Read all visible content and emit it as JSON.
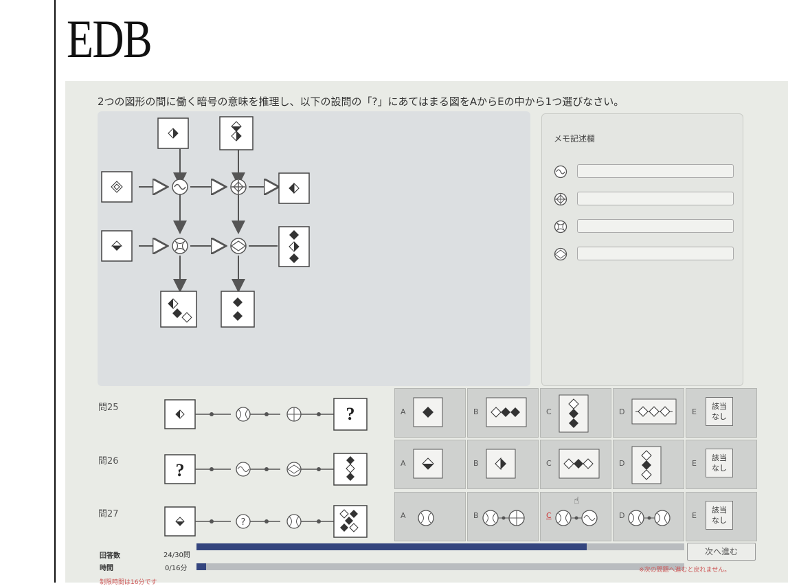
{
  "brand": "EDB",
  "instruction": "2つの図形の間に働く暗号の意味を推理し、以下の設問の「?」にあてはまる図をAからEの中から1つ選びなさい。",
  "memo": {
    "title": "メモ記述欄",
    "rows": [
      {
        "symbol": "wave-circle-icon",
        "value": ""
      },
      {
        "symbol": "cross-circle-icon",
        "value": ""
      },
      {
        "symbol": "swirl-circle-icon",
        "value": ""
      },
      {
        "symbol": "diamond-circle-icon",
        "value": ""
      }
    ]
  },
  "questions": [
    {
      "label": "問25",
      "start": "?",
      "end": "?",
      "choices": [
        "A",
        "B",
        "C",
        "D",
        "E"
      ],
      "none_label": "該当\nなし"
    },
    {
      "label": "問26",
      "start": "?",
      "end": "?",
      "choices": [
        "A",
        "B",
        "C",
        "D",
        "E"
      ],
      "none_label": "該当\nなし"
    },
    {
      "label": "問27",
      "start": "",
      "end": "",
      "choices": [
        "A",
        "B",
        "C",
        "D",
        "E"
      ],
      "none_label": "該当\nなし"
    }
  ],
  "q25_start_mark": "?",
  "q26_start_mark": "?",
  "q27_middle_mark": "?",
  "status": {
    "answered_label": "回答数",
    "answered_value": "24/30問",
    "answered_fraction": 0.8,
    "time_label": "時間",
    "time_value": "0/16分",
    "time_fraction": 0.02
  },
  "next_button": "次へ進む",
  "warning": "※次の問題へ進むと戻れません。",
  "cutoff_note": "制限時間は16分です"
}
